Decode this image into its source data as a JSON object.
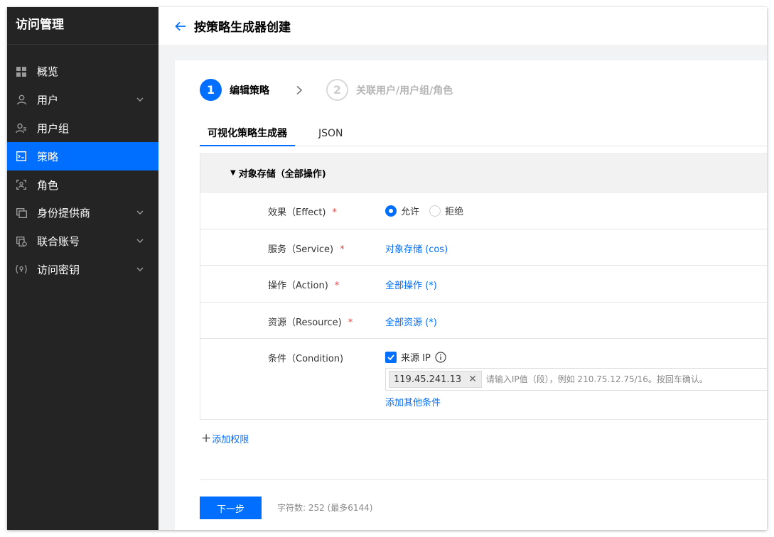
{
  "sidebar": {
    "title": "访问管理",
    "items": [
      {
        "label": "概览",
        "icon": "grid-icon",
        "chevron": false,
        "active": false
      },
      {
        "label": "用户",
        "icon": "user-icon",
        "chevron": true,
        "active": false
      },
      {
        "label": "用户组",
        "icon": "user-group-icon",
        "chevron": false,
        "active": false
      },
      {
        "label": "策略",
        "icon": "policy-icon",
        "chevron": false,
        "active": true
      },
      {
        "label": "角色",
        "icon": "role-icon",
        "chevron": false,
        "active": false
      },
      {
        "label": "身份提供商",
        "icon": "identity-provider-icon",
        "chevron": true,
        "active": false
      },
      {
        "label": "联合账号",
        "icon": "federated-account-icon",
        "chevron": true,
        "active": false
      },
      {
        "label": "访问密钥",
        "icon": "access-key-icon",
        "chevron": true,
        "active": false
      }
    ]
  },
  "header": {
    "title": "按策略生成器创建"
  },
  "steps": [
    {
      "number": "1",
      "label": "编辑策略",
      "state": "active"
    },
    {
      "number": "2",
      "label": "关联用户/用户组/角色",
      "state": "inactive"
    }
  ],
  "tabs": [
    {
      "label": "可视化策略生成器",
      "active": true
    },
    {
      "label": "JSON",
      "active": false
    }
  ],
  "panel": {
    "title": "对象存储（全部操作)",
    "effect": {
      "label": "效果（Effect)",
      "options": [
        "允许",
        "拒绝"
      ],
      "selected": "允许"
    },
    "service": {
      "label": "服务（Service)",
      "value": "对象存储 (cos)"
    },
    "action": {
      "label": "操作（Action)",
      "value": "全部操作 (*)"
    },
    "resource": {
      "label": "资源（Resource)",
      "value": "全部资源 (*)"
    },
    "condition": {
      "label": "条件（Condition)",
      "checkbox_label": "来源 IP",
      "checked": true,
      "ip_tag": "119.45.241.13",
      "placeholder": "请输入IP值（段），例如 210.75.12.75/16。按回车确认。",
      "add_condition": "添加其他条件"
    },
    "required_mark": "*"
  },
  "add_permission": "添加权限",
  "footer": {
    "next_button": "下一步",
    "char_count": "字符数: 252 (最多6144)"
  },
  "colors": {
    "accent": "#006eff",
    "sidebar_bg": "#242424",
    "required": "#e54545"
  }
}
